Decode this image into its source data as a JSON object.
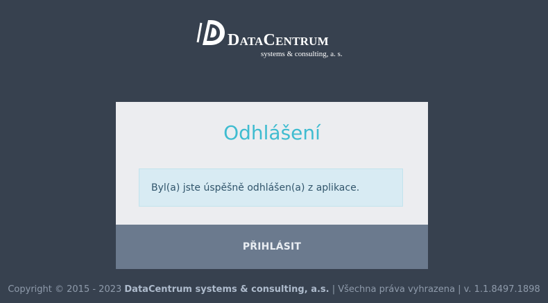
{
  "logo": {
    "name_first": "D",
    "name_rest_1": "ATA",
    "name_c": "C",
    "name_rest_2": "ENTRUM",
    "subtitle": "systems & consulting, a. s."
  },
  "panel": {
    "title": "Odhlášení",
    "message": "Byl(a) jste úspěšně odhlášen(a) z aplikace.",
    "login_button": "PŘIHLÁSIT"
  },
  "footer": {
    "copyright": "Copyright © 2015 - 2023 ",
    "company": "DataCentrum systems & consulting, a.s.",
    "rights": " | Všechna práva vyhrazena | ",
    "version": "v. 1.1.8497.1898"
  },
  "colors": {
    "background": "#37414f",
    "panel": "#ecedf0",
    "title": "#3fbcd0",
    "alert_bg": "#d8ebf3",
    "button_bg": "#6b7a8e"
  },
  "icons": {
    "logo_mark": "datacentrum-logo-icon"
  }
}
